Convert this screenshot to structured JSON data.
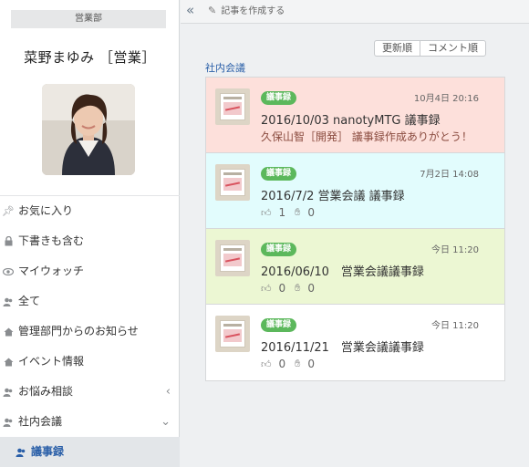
{
  "sidebar": {
    "department": "営業部",
    "user_name": "菜野まゆみ ［営業］",
    "nav": [
      {
        "label": "お気に入り",
        "icon": "pin-icon"
      },
      {
        "label": "下書きも含む",
        "icon": "lock-icon"
      },
      {
        "label": "マイウォッチ",
        "icon": "eye-icon"
      },
      {
        "label": "全て",
        "icon": "users-icon"
      },
      {
        "label": "管理部門からのお知らせ",
        "icon": "home-icon"
      },
      {
        "label": "イベント情報",
        "icon": "home-icon"
      },
      {
        "label": "お悩み相談",
        "icon": "users-icon",
        "chevron": "‹"
      },
      {
        "label": "社内会議",
        "icon": "users-icon",
        "chevron": "⌄"
      },
      {
        "label": "議事録",
        "icon": "users-icon",
        "active": true
      }
    ]
  },
  "topbar": {
    "collapse_glyph": "«",
    "compose_label": "記事を作成する"
  },
  "sort": {
    "updated": "更新順",
    "comments": "コメント順"
  },
  "section_label": "社内会議",
  "posts": [
    {
      "badge": "議事録",
      "timestamp": "10月4日 20:16",
      "title": "2016/10/03 nanotyMTG 議事録",
      "comment_author": "久保山智［開発］",
      "comment_text": "議事録作成ありがとう！",
      "bg": "#fde0db"
    },
    {
      "badge": "議事録",
      "timestamp": "7月2日 14:08",
      "title": "2016/7/2 営業会議 議事録",
      "likes": "1",
      "claps": "0",
      "bg": "#e2fcfd"
    },
    {
      "badge": "議事録",
      "timestamp": "今日 11:20",
      "title": "2016/06/10　営業会議議事録",
      "likes": "0",
      "claps": "0",
      "bg": "#ecf7d3"
    },
    {
      "badge": "議事録",
      "timestamp": "今日 11:20",
      "title": "2016/11/21　営業会議議事録",
      "likes": "0",
      "claps": "0",
      "bg": "#ffffff"
    }
  ],
  "colors": {
    "accent": "#2a5fa8",
    "badge": "#5cb85c"
  }
}
